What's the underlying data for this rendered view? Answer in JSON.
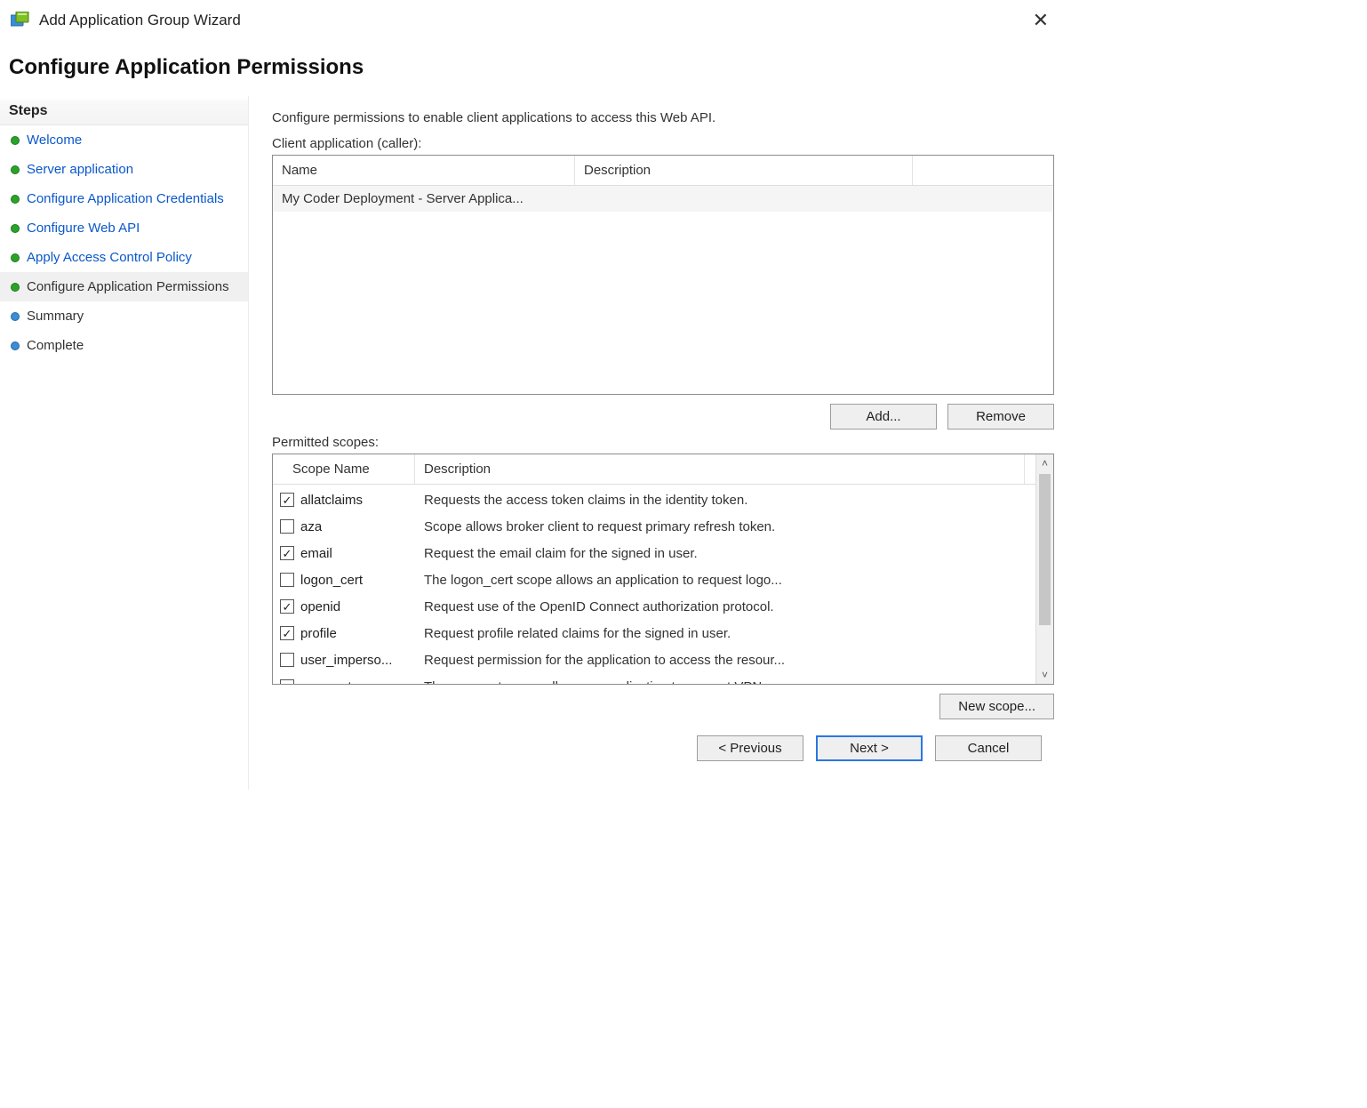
{
  "titlebar": {
    "title": "Add Application Group Wizard"
  },
  "page": {
    "heading": "Configure Application Permissions"
  },
  "sidebar": {
    "header": "Steps",
    "steps": [
      {
        "label": "Welcome",
        "state": "done"
      },
      {
        "label": "Server application",
        "state": "done"
      },
      {
        "label": "Configure Application Credentials",
        "state": "done"
      },
      {
        "label": "Configure Web API",
        "state": "done"
      },
      {
        "label": "Apply Access Control Policy",
        "state": "done"
      },
      {
        "label": "Configure Application Permissions",
        "state": "current"
      },
      {
        "label": "Summary",
        "state": "pending"
      },
      {
        "label": "Complete",
        "state": "pending"
      }
    ]
  },
  "main": {
    "intro": "Configure permissions to enable client applications to access this Web API.",
    "client_label": "Client application (caller):",
    "client_headers": {
      "name": "Name",
      "description": "Description"
    },
    "client_rows": [
      {
        "name": "My Coder Deployment - Server Applica...",
        "description": ""
      }
    ],
    "buttons": {
      "add": "Add...",
      "remove": "Remove",
      "new_scope": "New scope..."
    },
    "scopes_label": "Permitted scopes:",
    "scopes_headers": {
      "name": "Scope Name",
      "description": "Description"
    },
    "scopes": [
      {
        "checked": true,
        "name": "allatclaims",
        "description": "Requests the access token claims in the identity token."
      },
      {
        "checked": false,
        "name": "aza",
        "description": "Scope allows broker client to request primary refresh token."
      },
      {
        "checked": true,
        "name": "email",
        "description": "Request the email claim for the signed in user."
      },
      {
        "checked": false,
        "name": "logon_cert",
        "description": "The logon_cert scope allows an application to request logo..."
      },
      {
        "checked": true,
        "name": "openid",
        "description": "Request use of the OpenID Connect authorization protocol."
      },
      {
        "checked": true,
        "name": "profile",
        "description": "Request profile related claims for the signed in user."
      },
      {
        "checked": false,
        "name": "user_imperso...",
        "description": "Request permission for the application to access the resour..."
      },
      {
        "checked": false,
        "name": "vpn_cert",
        "description": "The vpn_cert scope allows an application to request VPN ..."
      }
    ]
  },
  "footer": {
    "previous": "< Previous",
    "next": "Next >",
    "cancel": "Cancel"
  }
}
